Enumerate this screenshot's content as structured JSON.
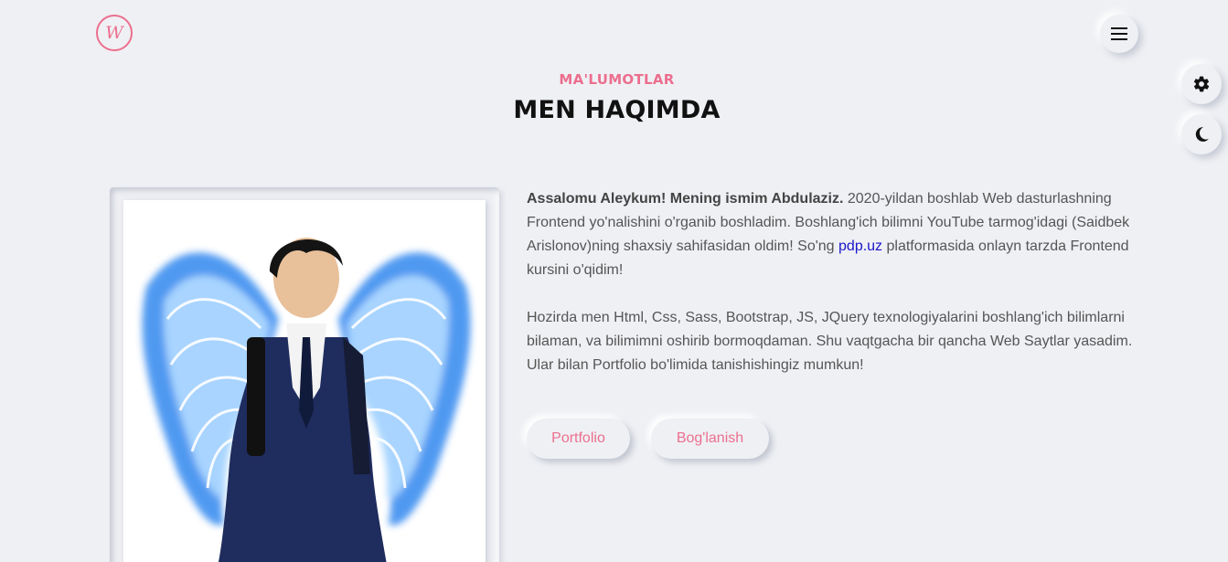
{
  "logo": {
    "letter": "W"
  },
  "header": {
    "eyebrow": "MA'LUMOTLAR",
    "title": "MEN HAQIMDA"
  },
  "about": {
    "p1_bold": "Assalomu Aleykum! Mening ismim Abdulaziz.",
    "p1_before_link": " 2020-yildan boshlab Web dasturlashning Frontend yo'nalishini o'rganib boshladim. Boshlang'ich bilimni YouTube tarmog'idagi (Saidbek Arislonov)ning shaxsiy sahifasidan oldim! So'ng ",
    "p1_link": "pdp.uz",
    "p1_after_link": " platformasida onlayn tarzda Frontend kursini o'qidim!",
    "p2": "Hozirda men Html, Css, Sass, Bootstrap, JS, JQuery texnologiyalarini boshlang'ich bilimlarni bilaman, va bilimimni oshirib bormoqdaman. Shu vaqtgacha bir qancha Web Saytlar yasadim. Ular bilan Portfolio bo'limida tanishishingiz mumkun!"
  },
  "buttons": {
    "portfolio": "Portfolio",
    "contact": "Bog'lanish"
  },
  "icons": {
    "menu": "menu-icon",
    "settings": "gear-icon",
    "theme": "moon-icon"
  },
  "colors": {
    "accent": "#ec6f8e",
    "background": "#eff0f4",
    "link": "#1a16c8"
  }
}
